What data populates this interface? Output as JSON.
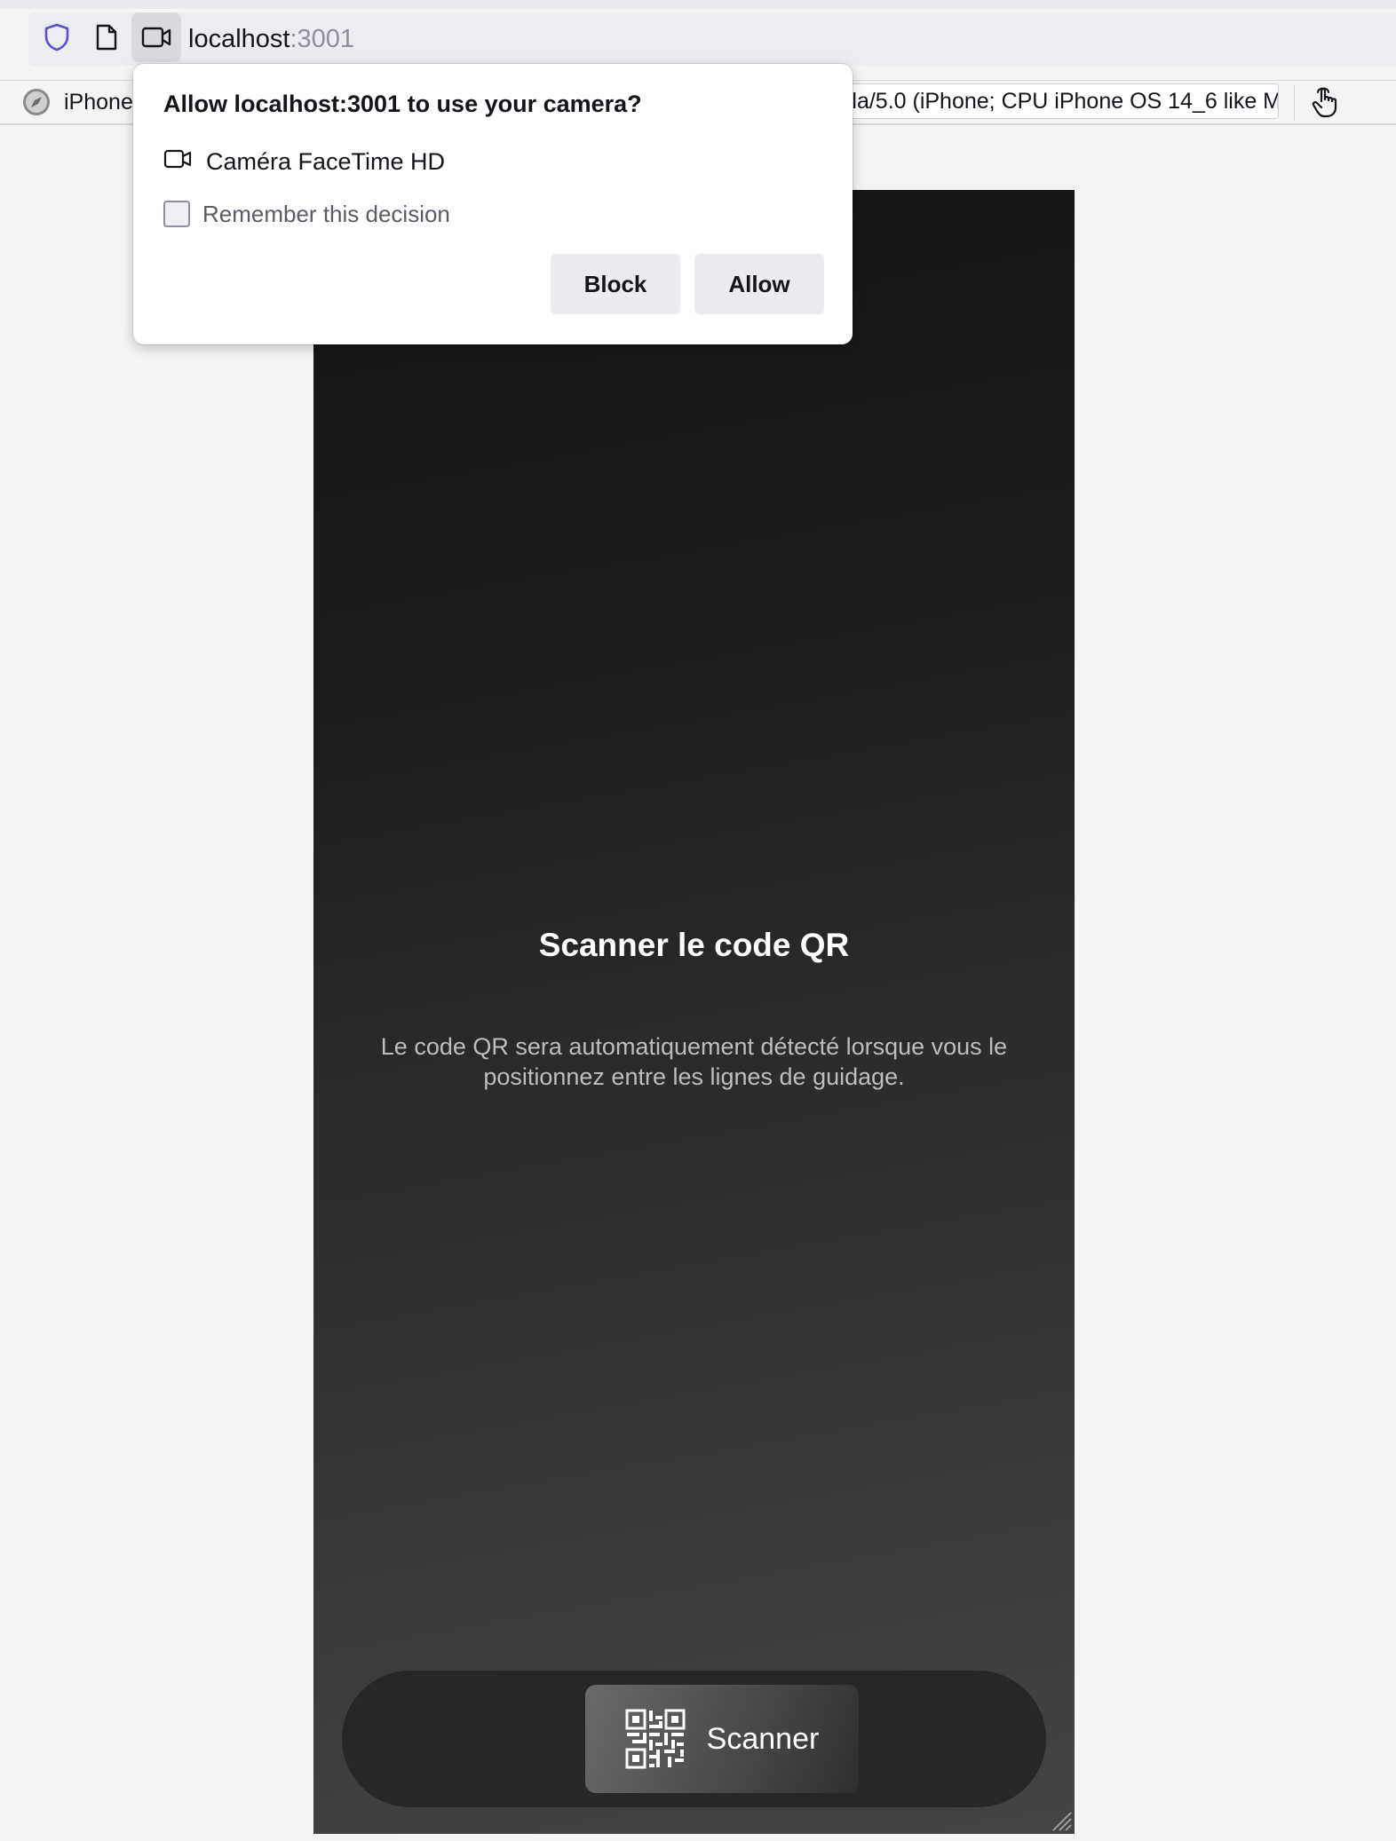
{
  "browser": {
    "url_host": "localhost",
    "url_port": ":3001",
    "device_name": "iPhone",
    "user_agent": "Mozilla/5.0 (iPhone; CPU iPhone OS 14_6 like M"
  },
  "permission_popup": {
    "title": "Allow localhost:3001 to use your camera?",
    "device": "Caméra FaceTime HD",
    "remember_label": "Remember this decision",
    "remember_checked": false,
    "block_label": "Block",
    "allow_label": "Allow"
  },
  "app": {
    "title": "Scanner le code QR",
    "description": "Le code QR sera automatiquement détecté lorsque vous le positionnez entre les lignes de guidage.",
    "scan_button_label": "Scanner"
  },
  "icons": {
    "shield": "shield-icon",
    "page": "page-icon",
    "camera": "camera-icon",
    "device": "compass-icon",
    "touch": "touch-icon",
    "qr": "qr-code-icon"
  },
  "colors": {
    "accent_shield": "#5a4fcf",
    "viewport_top": "#141414",
    "viewport_bottom": "#444444",
    "bottom_bar": "#272727"
  }
}
